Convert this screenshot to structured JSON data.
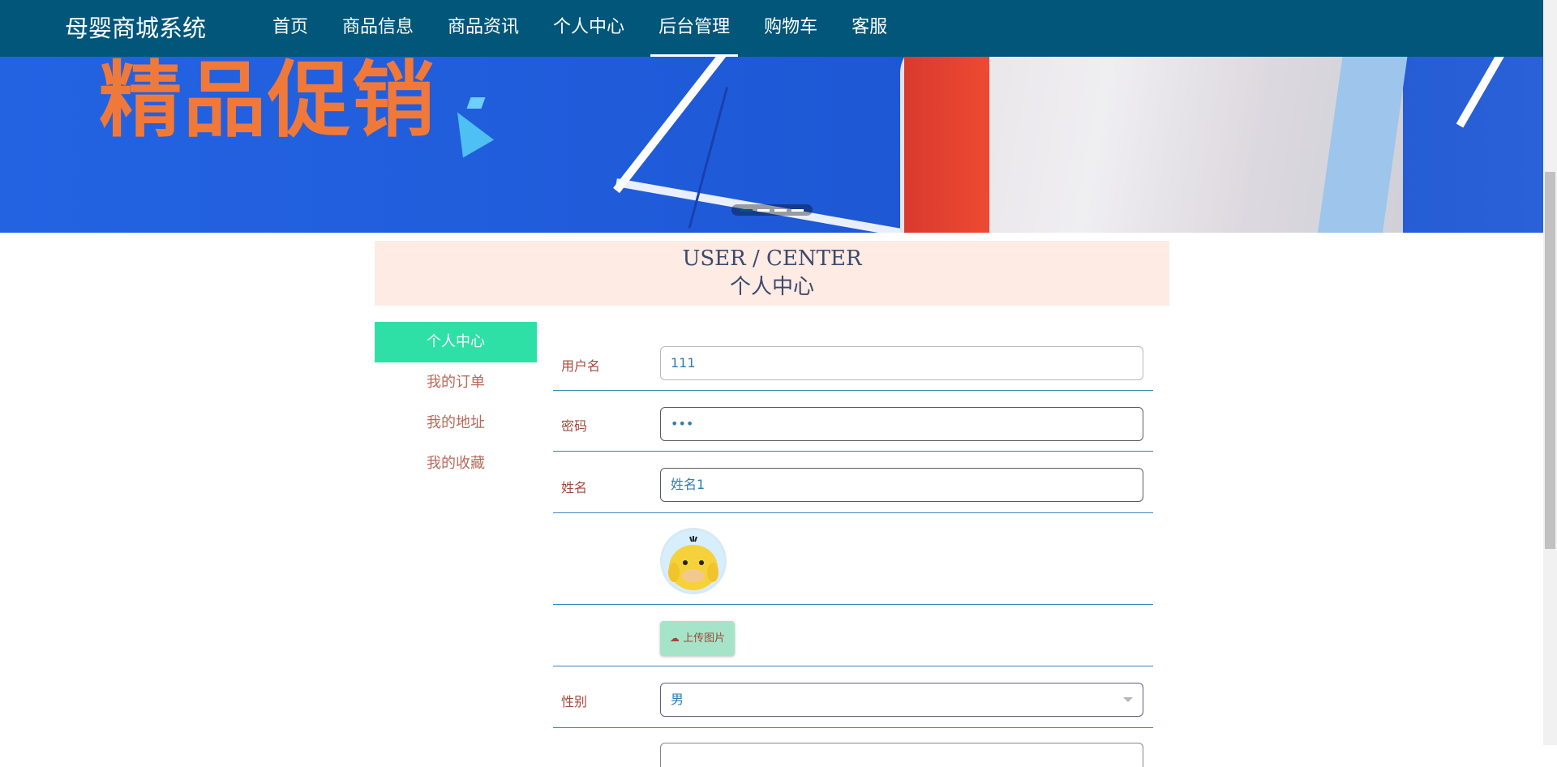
{
  "brand": "母婴商城系统",
  "nav": [
    {
      "label": "首页",
      "active": false
    },
    {
      "label": "商品信息",
      "active": false
    },
    {
      "label": "商品资讯",
      "active": false
    },
    {
      "label": "个人中心",
      "active": false
    },
    {
      "label": "后台管理",
      "active": true
    },
    {
      "label": "购物车",
      "active": false
    },
    {
      "label": "客服",
      "active": false
    }
  ],
  "banner": {
    "title": "精品促销",
    "slide_count": 4,
    "active_slide": 1
  },
  "center": {
    "title_en": "USER / CENTER",
    "title_cn": "个人中心"
  },
  "side_menu": [
    {
      "label": "个人中心",
      "active": true
    },
    {
      "label": "我的订单",
      "active": false
    },
    {
      "label": "我的地址",
      "active": false
    },
    {
      "label": "我的收藏",
      "active": false
    }
  ],
  "form": {
    "username_label": "用户名",
    "username_value": "111",
    "password_label": "密码",
    "password_value": "•••",
    "name_label": "姓名",
    "name_value": "姓名1",
    "upload_label": "上传图片",
    "gender_label": "性别",
    "gender_value": "男"
  },
  "colors": {
    "nav_bg": "#01567a",
    "active_menu": "#2ee0a6",
    "header_bg": "#fdebe4",
    "label": "#a04b3d",
    "value": "#2f7eb2"
  },
  "icons": {
    "upload": "cloud-upload-icon",
    "select": "chevron-down-icon",
    "avatar": "duck-avatar-icon"
  }
}
